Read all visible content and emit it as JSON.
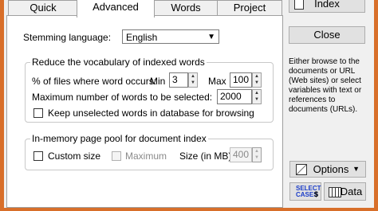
{
  "tabs": [
    {
      "label": "Quick",
      "active": false
    },
    {
      "label": "Advanced",
      "active": true
    },
    {
      "label": "Words",
      "active": false
    },
    {
      "label": "Project",
      "active": false
    }
  ],
  "stemming": {
    "label": "Stemming language:",
    "value": "English"
  },
  "vocab_group": {
    "title": "Reduce the vocabulary of indexed words",
    "pct_label": "% of files where word occurs:",
    "min_label": "Min",
    "min_value": "3",
    "max_label": "Max",
    "max_value": "100",
    "maxwords_label": "Maximum number of words to be selected:",
    "maxwords_value": "2000",
    "keep_label": "Keep unselected words in database for browsing"
  },
  "memory_group": {
    "title": "In-memory page pool for document index",
    "custom_label": "Custom size",
    "maximum_label": "Maximum",
    "size_label": "Size (in MB):",
    "size_value": "400"
  },
  "right": {
    "index_label": "Index",
    "close_label": "Close",
    "info_text": "Either browse to the documents or URL (Web sites) or select variables with text or references to documents (URLs).",
    "options_label": "Options",
    "select_cases_label": "SELECT CASES",
    "data_label": "Data"
  },
  "colors": {
    "frame": "#d86f2a",
    "panel": "#ffffff",
    "background": "#f0f0f0"
  }
}
